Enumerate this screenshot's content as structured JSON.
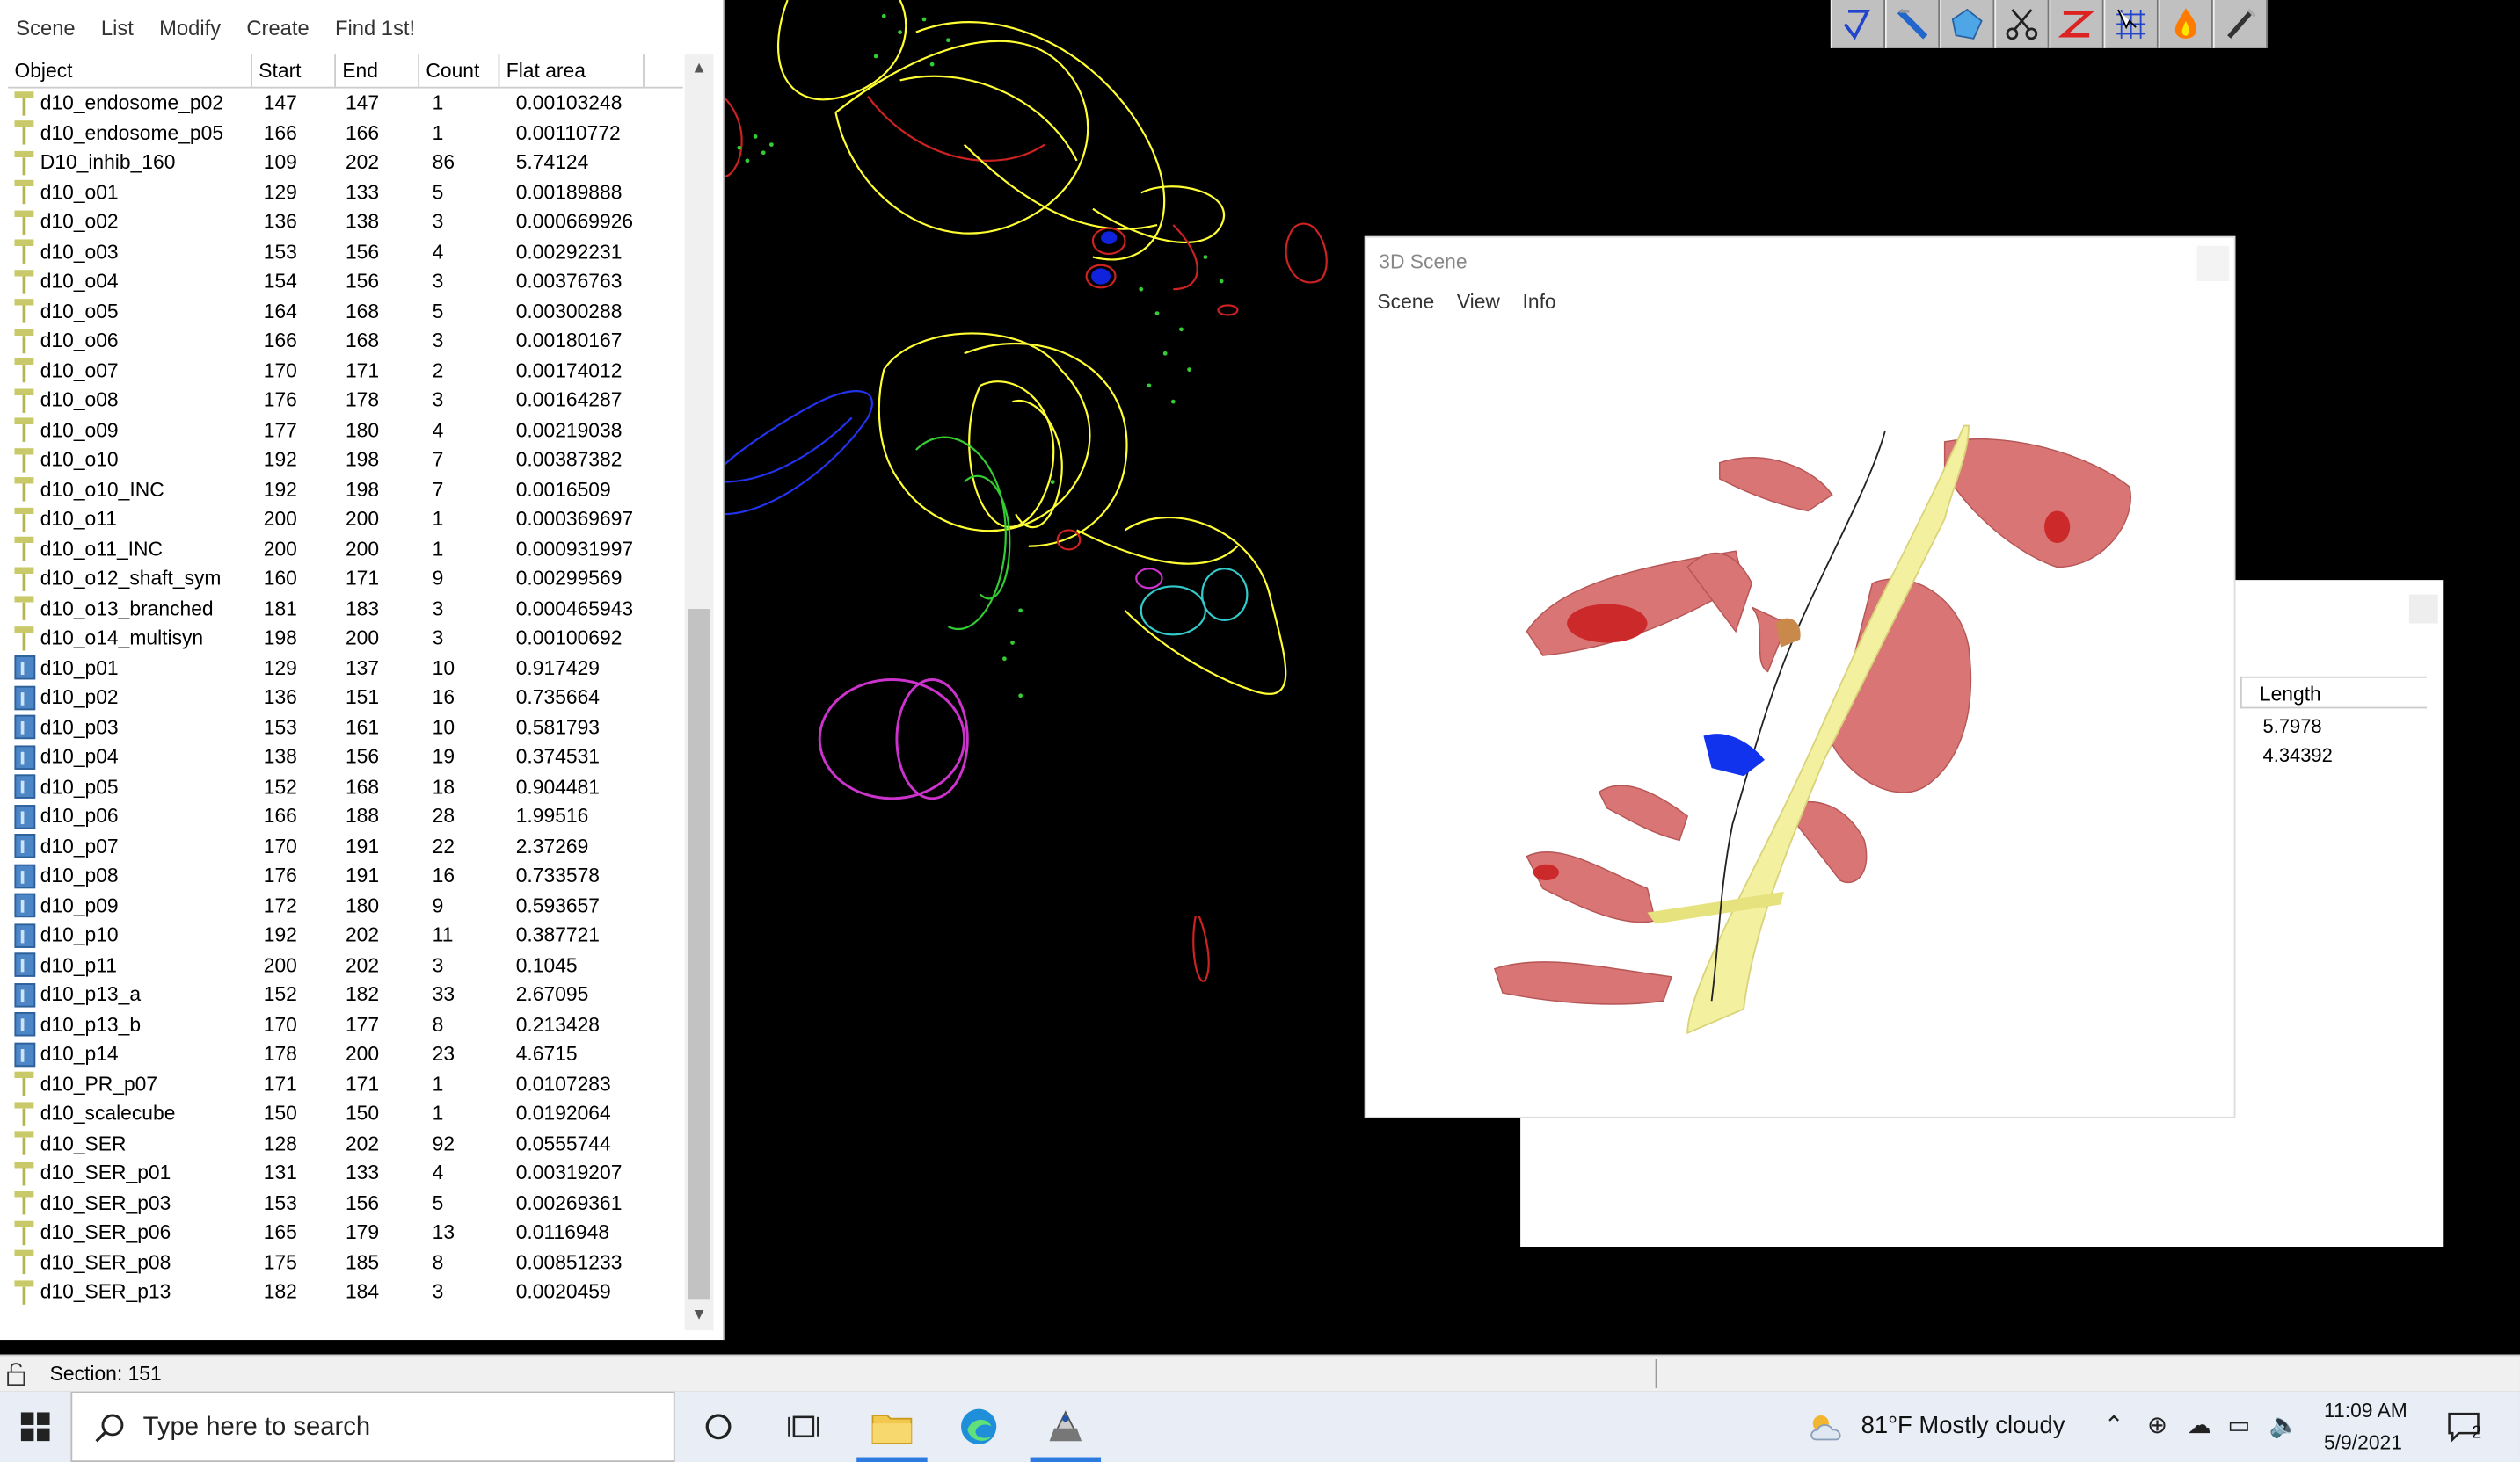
{
  "object_window": {
    "menu": [
      "Scene",
      "List",
      "Modify",
      "Create",
      "Find 1st!"
    ],
    "columns": [
      "Object",
      "Start",
      "End",
      "Count",
      "Flat area"
    ],
    "rows": [
      {
        "icon": "trace",
        "name": "d10_endosome_p02",
        "start": "147",
        "end": "147",
        "count": "1",
        "area": "0.00103248"
      },
      {
        "icon": "trace",
        "name": "d10_endosome_p05",
        "start": "166",
        "end": "166",
        "count": "1",
        "area": "0.00110772"
      },
      {
        "icon": "trace",
        "name": "D10_inhib_160",
        "start": "109",
        "end": "202",
        "count": "86",
        "area": "5.74124"
      },
      {
        "icon": "trace",
        "name": "d10_o01",
        "start": "129",
        "end": "133",
        "count": "5",
        "area": "0.00189888"
      },
      {
        "icon": "trace",
        "name": "d10_o02",
        "start": "136",
        "end": "138",
        "count": "3",
        "area": "0.000669926"
      },
      {
        "icon": "trace",
        "name": "d10_o03",
        "start": "153",
        "end": "156",
        "count": "4",
        "area": "0.00292231"
      },
      {
        "icon": "trace",
        "name": "d10_o04",
        "start": "154",
        "end": "156",
        "count": "3",
        "area": "0.00376763"
      },
      {
        "icon": "trace",
        "name": "d10_o05",
        "start": "164",
        "end": "168",
        "count": "5",
        "area": "0.00300288"
      },
      {
        "icon": "trace",
        "name": "d10_o06",
        "start": "166",
        "end": "168",
        "count": "3",
        "area": "0.00180167"
      },
      {
        "icon": "trace",
        "name": "d10_o07",
        "start": "170",
        "end": "171",
        "count": "2",
        "area": "0.00174012"
      },
      {
        "icon": "trace",
        "name": "d10_o08",
        "start": "176",
        "end": "178",
        "count": "3",
        "area": "0.00164287"
      },
      {
        "icon": "trace",
        "name": "d10_o09",
        "start": "177",
        "end": "180",
        "count": "4",
        "area": "0.00219038"
      },
      {
        "icon": "trace",
        "name": "d10_o10",
        "start": "192",
        "end": "198",
        "count": "7",
        "area": "0.00387382"
      },
      {
        "icon": "trace",
        "name": "d10_o10_INC",
        "start": "192",
        "end": "198",
        "count": "7",
        "area": "0.0016509"
      },
      {
        "icon": "trace",
        "name": "d10_o11",
        "start": "200",
        "end": "200",
        "count": "1",
        "area": "0.000369697"
      },
      {
        "icon": "trace",
        "name": "d10_o11_INC",
        "start": "200",
        "end": "200",
        "count": "1",
        "area": "0.000931997"
      },
      {
        "icon": "trace",
        "name": "d10_o12_shaft_sym",
        "start": "160",
        "end": "171",
        "count": "9",
        "area": "0.00299569"
      },
      {
        "icon": "trace",
        "name": "d10_o13_branched",
        "start": "181",
        "end": "183",
        "count": "3",
        "area": "0.000465943"
      },
      {
        "icon": "trace",
        "name": "d10_o14_multisyn",
        "start": "198",
        "end": "200",
        "count": "3",
        "area": "0.00100692"
      },
      {
        "icon": "traceset",
        "name": "d10_p01",
        "start": "129",
        "end": "137",
        "count": "10",
        "area": "0.917429"
      },
      {
        "icon": "traceset",
        "name": "d10_p02",
        "start": "136",
        "end": "151",
        "count": "16",
        "area": "0.735664"
      },
      {
        "icon": "traceset",
        "name": "d10_p03",
        "start": "153",
        "end": "161",
        "count": "10",
        "area": "0.581793"
      },
      {
        "icon": "traceset",
        "name": "d10_p04",
        "start": "138",
        "end": "156",
        "count": "19",
        "area": "0.374531"
      },
      {
        "icon": "traceset",
        "name": "d10_p05",
        "start": "152",
        "end": "168",
        "count": "18",
        "area": "0.904481"
      },
      {
        "icon": "traceset",
        "name": "d10_p06",
        "start": "166",
        "end": "188",
        "count": "28",
        "area": "1.99516"
      },
      {
        "icon": "traceset",
        "name": "d10_p07",
        "start": "170",
        "end": "191",
        "count": "22",
        "area": "2.37269"
      },
      {
        "icon": "traceset",
        "name": "d10_p08",
        "start": "176",
        "end": "191",
        "count": "16",
        "area": "0.733578"
      },
      {
        "icon": "traceset",
        "name": "d10_p09",
        "start": "172",
        "end": "180",
        "count": "9",
        "area": "0.593657"
      },
      {
        "icon": "traceset",
        "name": "d10_p10",
        "start": "192",
        "end": "202",
        "count": "11",
        "area": "0.387721"
      },
      {
        "icon": "traceset",
        "name": "d10_p11",
        "start": "200",
        "end": "202",
        "count": "3",
        "area": "0.1045"
      },
      {
        "icon": "traceset",
        "name": "d10_p13_a",
        "start": "152",
        "end": "182",
        "count": "33",
        "area": "2.67095"
      },
      {
        "icon": "traceset",
        "name": "d10_p13_b",
        "start": "170",
        "end": "177",
        "count": "8",
        "area": "0.213428"
      },
      {
        "icon": "traceset",
        "name": "d10_p14",
        "start": "178",
        "end": "200",
        "count": "23",
        "area": "4.6715"
      },
      {
        "icon": "trace",
        "name": "d10_PR_p07",
        "start": "171",
        "end": "171",
        "count": "1",
        "area": "0.0107283"
      },
      {
        "icon": "trace",
        "name": "d10_scalecube",
        "start": "150",
        "end": "150",
        "count": "1",
        "area": "0.0192064"
      },
      {
        "icon": "trace",
        "name": "d10_SER",
        "start": "128",
        "end": "202",
        "count": "92",
        "area": "0.0555744"
      },
      {
        "icon": "trace",
        "name": "d10_SER_p01",
        "start": "131",
        "end": "133",
        "count": "4",
        "area": "0.00319207"
      },
      {
        "icon": "trace",
        "name": "d10_SER_p03",
        "start": "153",
        "end": "156",
        "count": "5",
        "area": "0.00269361"
      },
      {
        "icon": "trace",
        "name": "d10_SER_p06",
        "start": "165",
        "end": "179",
        "count": "13",
        "area": "0.0116948"
      },
      {
        "icon": "trace",
        "name": "d10_SER_p08",
        "start": "175",
        "end": "185",
        "count": "8",
        "area": "0.00851233"
      },
      {
        "icon": "trace",
        "name": "d10_SER_p13",
        "start": "182",
        "end": "184",
        "count": "3",
        "area": "0.0020459"
      }
    ]
  },
  "scene_window": {
    "title": "3D Scene",
    "menu": [
      "Scene",
      "View",
      "Info"
    ]
  },
  "length_window": {
    "header": "Length",
    "values": [
      "5.7978",
      "4.34392"
    ]
  },
  "status": {
    "section": "Section: 151"
  },
  "taskbar": {
    "search_placeholder": "Type here to search",
    "weather": "81°F  Mostly cloudy",
    "time": "11:09 AM",
    "date": "5/9/2021",
    "notifications": "2"
  },
  "colors": {
    "trace_yellow": "#ffff33",
    "trace_green": "#33cc33",
    "accent": "#2b7be0"
  }
}
